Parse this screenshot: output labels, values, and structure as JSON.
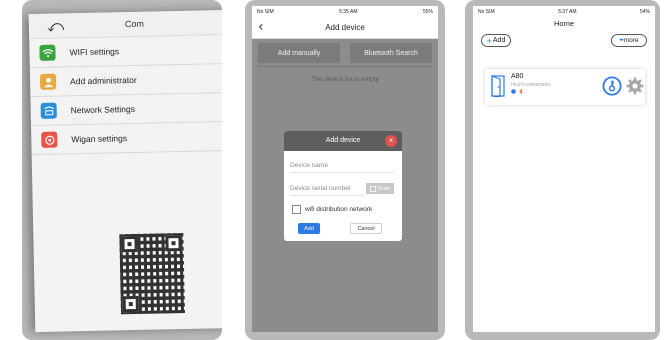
{
  "panel1": {
    "title": "Com",
    "back_glyph": "⤺",
    "items": [
      {
        "label": "WIFI settings",
        "icon": "wifi-icon",
        "color": "#3aa43f"
      },
      {
        "label": "Add administrator",
        "icon": "user-icon",
        "color": "#e9a941"
      },
      {
        "label": "Network Settings",
        "icon": "network-icon",
        "color": "#2a8fd6"
      },
      {
        "label": "Wigan settings",
        "icon": "wiegand-icon",
        "color": "#e8534a"
      }
    ]
  },
  "panel2": {
    "status": {
      "carrier": "No SIM",
      "time": "5:35 AM",
      "battery": "55%"
    },
    "title": "Add device",
    "back_glyph": "‹",
    "buttons": {
      "add_manually": "Add manually",
      "bluetooth_search": "Bluetooth Search"
    },
    "empty_text": "The device list is empty",
    "dialog": {
      "title": "Add device",
      "close_glyph": "×",
      "device_name_placeholder": "Device name",
      "serial_placeholder": "Device serial number",
      "scan_label": "Scan",
      "checkbox_label": "wifi distribution network",
      "add_label": "Add",
      "cancel_label": "Cancel"
    }
  },
  "panel3": {
    "status": {
      "carrier": "No SIM",
      "time": "5:37 AM",
      "battery": "54%"
    },
    "title": "Home",
    "add_label": "Add",
    "add_glyph": "+",
    "more_label": "more",
    "more_glyph": "•••",
    "device": {
      "name": "A80",
      "serial": "FE1FCA000003001",
      "accent": "#2d79e6"
    }
  }
}
